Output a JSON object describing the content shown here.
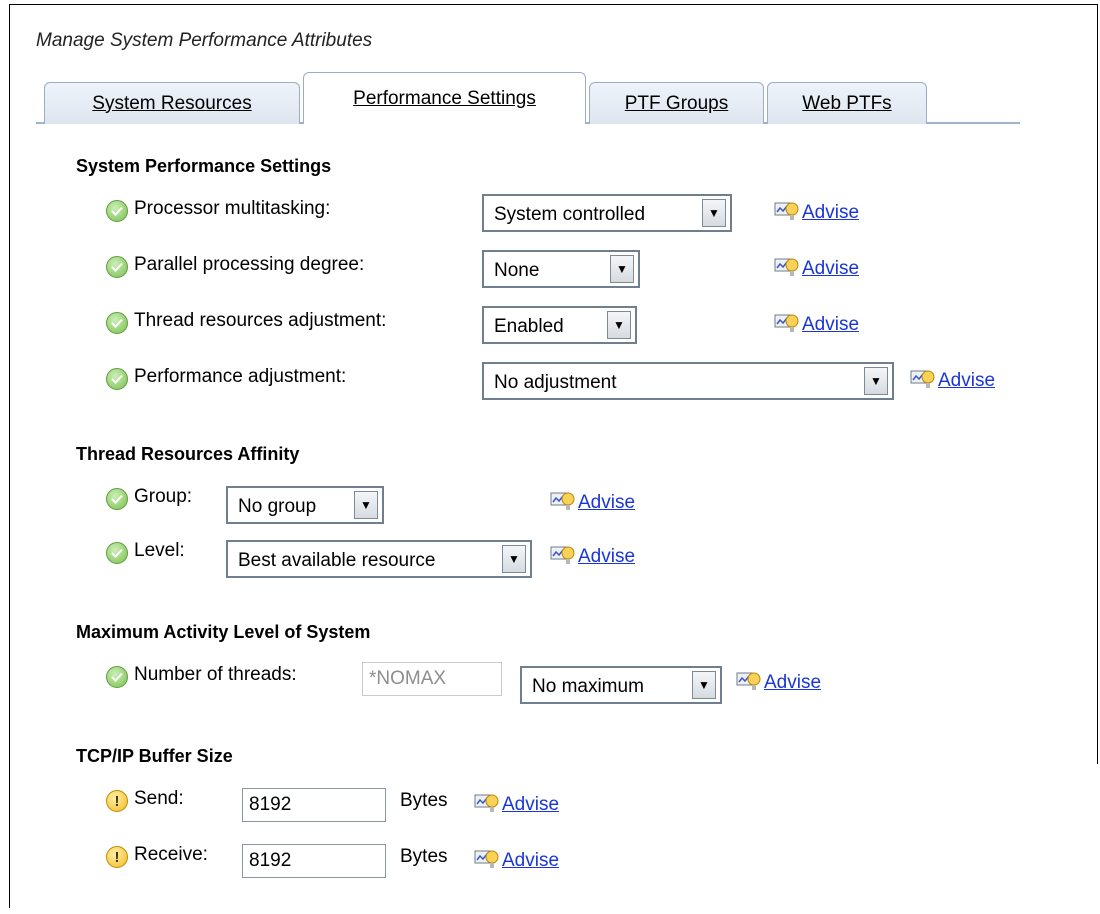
{
  "header": {
    "title": "Manage System Performance Attributes"
  },
  "tabs": [
    {
      "label": "System Resources"
    },
    {
      "label": "Performance Settings"
    },
    {
      "label": "PTF Groups"
    },
    {
      "label": "Web PTFs"
    }
  ],
  "links": {
    "advise": "Advise"
  },
  "sections": {
    "performance": {
      "title": "System Performance Settings",
      "processor": {
        "label": "Processor multitasking:",
        "value": "System controlled"
      },
      "parallel": {
        "label": "Parallel processing degree:",
        "value": "None"
      },
      "thread": {
        "label": "Thread resources adjustment:",
        "value": "Enabled"
      },
      "perf_adj": {
        "label": "Performance adjustment:",
        "value": "No adjustment"
      }
    },
    "affinity": {
      "title": "Thread Resources Affinity",
      "group": {
        "label": "Group:",
        "value": "No group"
      },
      "level": {
        "label": "Level:",
        "value": "Best available resource"
      }
    },
    "activity": {
      "title": "Maximum Activity Level of System",
      "threads": {
        "label": "Number of threads:",
        "input": "*NOMAX",
        "value": "No maximum"
      }
    },
    "tcpip": {
      "title": "TCP/IP Buffer Size",
      "units": "Bytes",
      "send": {
        "label": "Send:",
        "value": "8192"
      },
      "receive": {
        "label": "Receive:",
        "value": "8192"
      }
    }
  },
  "icons": {
    "ok": "check-circle-icon",
    "warning": "exclamation-circle-icon",
    "advise": "chart-bulb-icon",
    "dropdown": "chevron-down-icon"
  },
  "colors": {
    "link": "#1a35d8",
    "ok": "#79c04f",
    "warning": "#f2b81d",
    "tab_border": "#9aaec6"
  }
}
